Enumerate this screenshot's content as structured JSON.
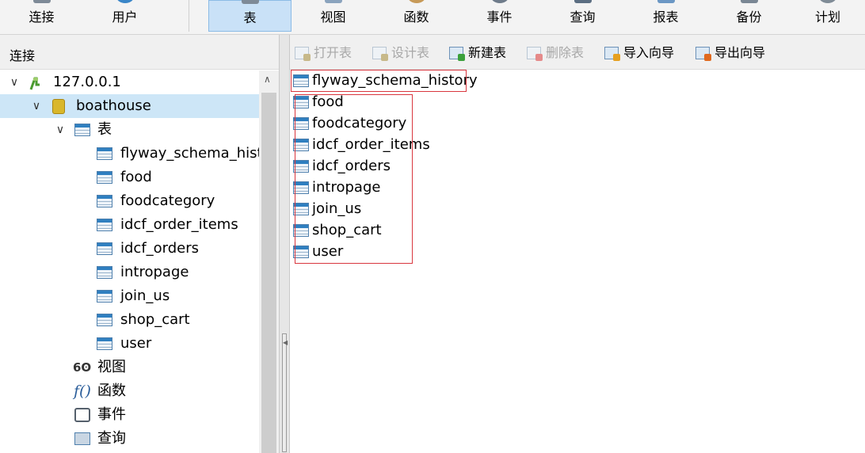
{
  "ribbon": {
    "items": [
      {
        "label": "连接",
        "icon": "connection-icon"
      },
      {
        "label": "用户",
        "icon": "user-icon"
      },
      {
        "label": "表",
        "icon": "table-icon",
        "active": true
      },
      {
        "label": "视图",
        "icon": "view-icon"
      },
      {
        "label": "函数",
        "icon": "function-icon"
      },
      {
        "label": "事件",
        "icon": "event-icon"
      },
      {
        "label": "查询",
        "icon": "query-icon"
      },
      {
        "label": "报表",
        "icon": "report-icon"
      },
      {
        "label": "备份",
        "icon": "backup-icon"
      },
      {
        "label": "计划",
        "icon": "schedule-icon"
      }
    ]
  },
  "left_panel": {
    "header": "连接",
    "connection": "127.0.0.1",
    "database": "boathouse",
    "tables_group": "表",
    "tables": [
      "flyway_schema_histo",
      "food",
      "foodcategory",
      "idcf_order_items",
      "idcf_orders",
      "intropage",
      "join_us",
      "shop_cart",
      "user"
    ],
    "views_group": "视图",
    "functions_group": "函数",
    "events_group": "事件",
    "queries_group": "查询"
  },
  "toolbar": {
    "open_table": "打开表",
    "design_table": "设计表",
    "new_table": "新建表",
    "delete_table": "删除表",
    "import_wizard": "导入向导",
    "export_wizard": "导出向导"
  },
  "objects": {
    "items": [
      "flyway_schema_history",
      "food",
      "foodcategory",
      "idcf_order_items",
      "idcf_orders",
      "intropage",
      "join_us",
      "shop_cart",
      "user"
    ]
  },
  "colors": {
    "selection": "#cde6f7",
    "ribbon_active": "#c9e1f7",
    "highlight_box": "#d9363e"
  }
}
